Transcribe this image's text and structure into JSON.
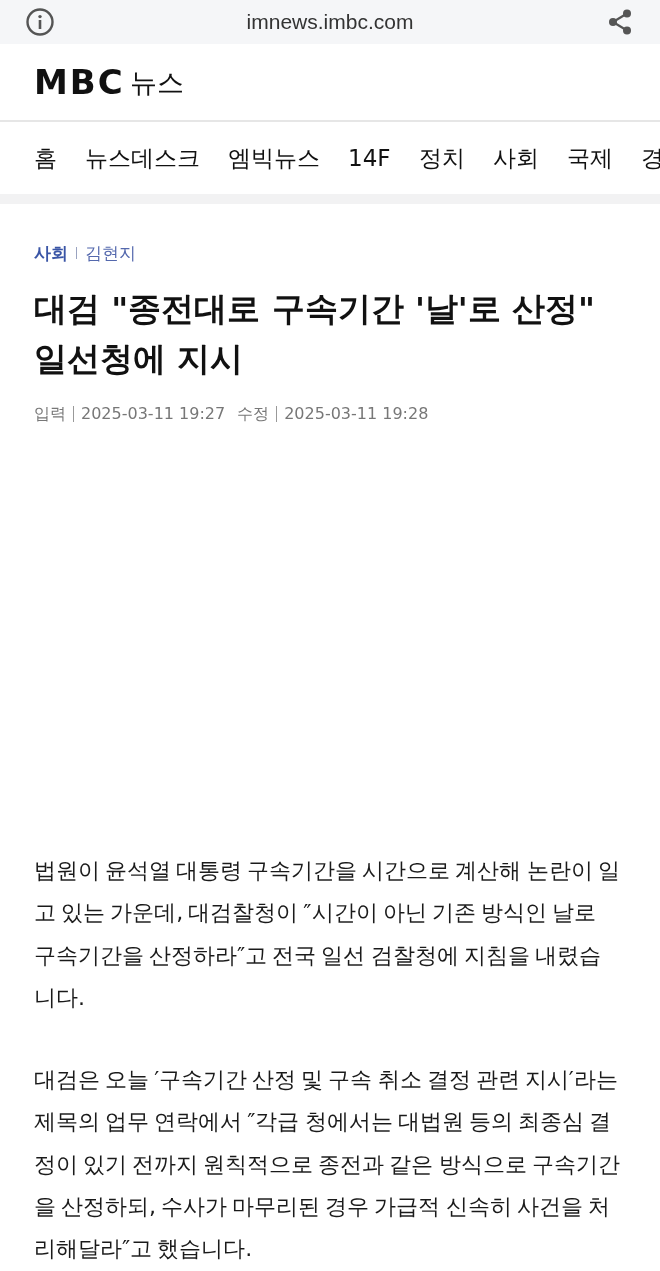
{
  "browser_bar": {
    "url": "imnews.imbc.com"
  },
  "header": {
    "logo": "MBC",
    "section": "뉴스"
  },
  "nav": {
    "items": [
      "홈",
      "뉴스데스크",
      "엠빅뉴스",
      "14F",
      "정치",
      "사회",
      "국제",
      "경"
    ]
  },
  "article": {
    "category": "사회",
    "author": "김현지",
    "title": "대검 \"종전대로 구속기간 '날'로 산정\" 일선청에 지시",
    "published_label": "입력",
    "published": "2025-03-11 19:27",
    "updated_label": "수정",
    "updated": "2025-03-11 19:28",
    "paragraphs": [
      "법원이 윤석열 대통령 구속기간을 시간으로 계산해 논란이 일고 있는 가운데, 대검찰청이 ″시간이 아닌 기존 방식인 날로 구속기간을 산정하라″고 전국 일선 검찰청에 지침을 내렸습니다.",
      "대검은 오늘 ′구속기간 산정 및 구속 취소 결정 관련 지시′라는 제목의 업무 연락에서 ″각급 청에서는 대법원 등의 최종심 결정이 있기 전까지 원칙적으로 종전과 같은 방식으로 구속기간을 산정하되, 수사가 마무리된 경우 가급적 신속히 사건을 처리해달라″고 했습니다."
    ]
  }
}
